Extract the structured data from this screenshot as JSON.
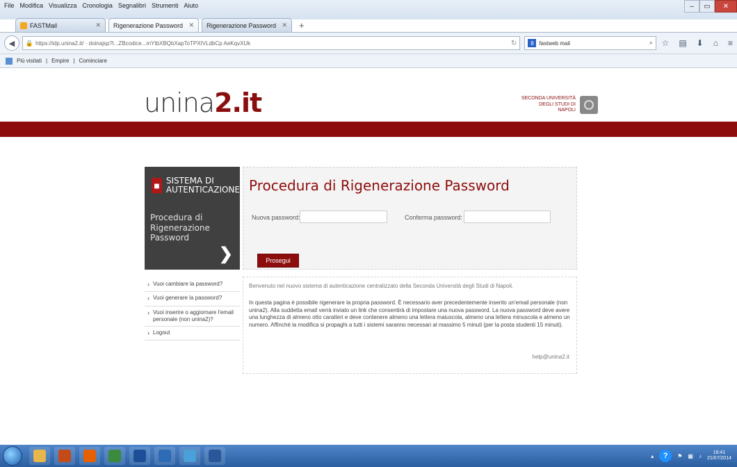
{
  "browser": {
    "menu": [
      "File",
      "Modifica",
      "Visualizza",
      "Cronologia",
      "Segnalibri",
      "Strumenti",
      "Aiuto"
    ],
    "tabs": [
      {
        "label": "FASTMail",
        "active": false
      },
      {
        "label": "Rigenerazione Password",
        "active": true
      },
      {
        "label": "Rigenerazione Password",
        "active": false
      }
    ],
    "url": "https://idp.unina2.it/ · doinajsp?l...ZBcodice...mYtbXBQbXapToTPXIVLdbCp AeKqvXUk",
    "search_engine": "8",
    "search_query": "fastweb mail",
    "bookmarks": [
      "Più visitati",
      "Empire",
      "Cominciare"
    ]
  },
  "header": {
    "logo_main": "unina",
    "logo_bold": "2.it",
    "uni_text": "SECONDA UNIVERSITÀ DEGLI STUDI DI NAPOLI"
  },
  "left_panel": {
    "title_line1": "SISTEMA DI",
    "title_line2": "AUTENTICAZIONE",
    "subtitle": "Procedura di Rigenerazione Password",
    "arrow": "❯"
  },
  "form": {
    "title": "Procedura di Rigenerazione Password",
    "new_password_label": "Nuova password:",
    "confirm_password_label": "Conferma password:",
    "new_password_value": "",
    "confirm_password_value": "",
    "submit_label": "Prosegui"
  },
  "side_menu": [
    "Vuoi cambiare la password?",
    "Vuoi generare la password?",
    "Vuoi inserire o aggiornare l'email personale (non unina2)?",
    "Logout"
  ],
  "info": {
    "welcome": "Benvenuto nel nuovo sistema di autenticazione centralizzato della Seconda Università degli Studi di Napoli.",
    "body": "In questa pagina è possibile rigenerare la propria password. È necessario aver precedentemente inserito un'email personale (non unina2). Alla suddetta email verrà inviato un link che consentirà di impostare una nuova password. La nuova password deve avere una lunghezza di almeno otto caratteri e deve contenere almeno una lettera maiuscola, almeno una lettera minuscola e almeno un numero. Affinché la modifica si propaghi a tutti i sistemi saranno necessari al massimo 5 minuti (per la posta studenti 15 minuti).",
    "help": "help@unina2.it"
  },
  "taskbar": {
    "clock_time": "16:41",
    "clock_date": "21/07/2014",
    "apps": [
      "explorer",
      "powerpoint",
      "firefox",
      "chrome",
      "unina",
      "outlook",
      "photo",
      "word"
    ],
    "app_colors": [
      "#e8b64a",
      "#c54a1a",
      "#e66000",
      "#3b8a3e",
      "#1d4f99",
      "#2d6bb6",
      "#4aa0d8",
      "#2b579a"
    ]
  }
}
